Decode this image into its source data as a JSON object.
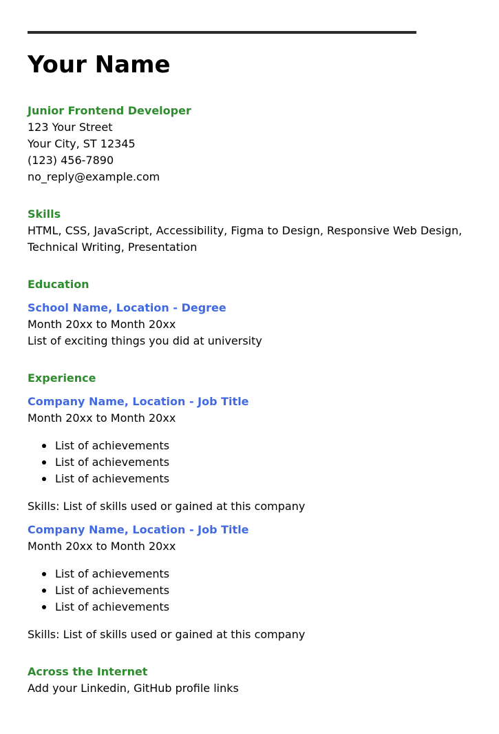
{
  "header": {
    "name": "Your Name",
    "role": "Junior Frontend Developer",
    "street": "123 Your Street",
    "city": "Your City, ST 12345",
    "phone": "(123) 456-7890",
    "email": "no_reply@example.com"
  },
  "skills": {
    "heading": "Skills",
    "line1": "HTML, CSS, JavaScript, Accessibility, Figma to Design, Responsive Web Design,",
    "line2": "Technical Writing, Presentation"
  },
  "education": {
    "heading": "Education",
    "title": "School Name, Location - Degree",
    "dates": "Month 20xx to Month 20xx",
    "desc": "List of exciting things you did at university"
  },
  "experience": {
    "heading": "Experience",
    "jobs": [
      {
        "title": "Company Name, Location - Job Title",
        "dates": "Month 20xx to Month 20xx",
        "achievements": [
          "List of achievements",
          "List of achievements",
          "List of achievements"
        ],
        "skills": "Skills: List of skills used or gained at this company"
      },
      {
        "title": "Company Name, Location - Job Title",
        "dates": "Month 20xx to Month 20xx",
        "achievements": [
          "List of achievements",
          "List of achievements",
          "List of achievements"
        ],
        "skills": "Skills: List of skills used or gained at this company"
      }
    ]
  },
  "internet": {
    "heading": "Across the Internet",
    "desc": "Add your Linkedin, GitHub profile links"
  },
  "colors": {
    "section_heading": "#2e8b2e",
    "entry_title": "#4169e1",
    "rule": "#2b2b2b"
  }
}
